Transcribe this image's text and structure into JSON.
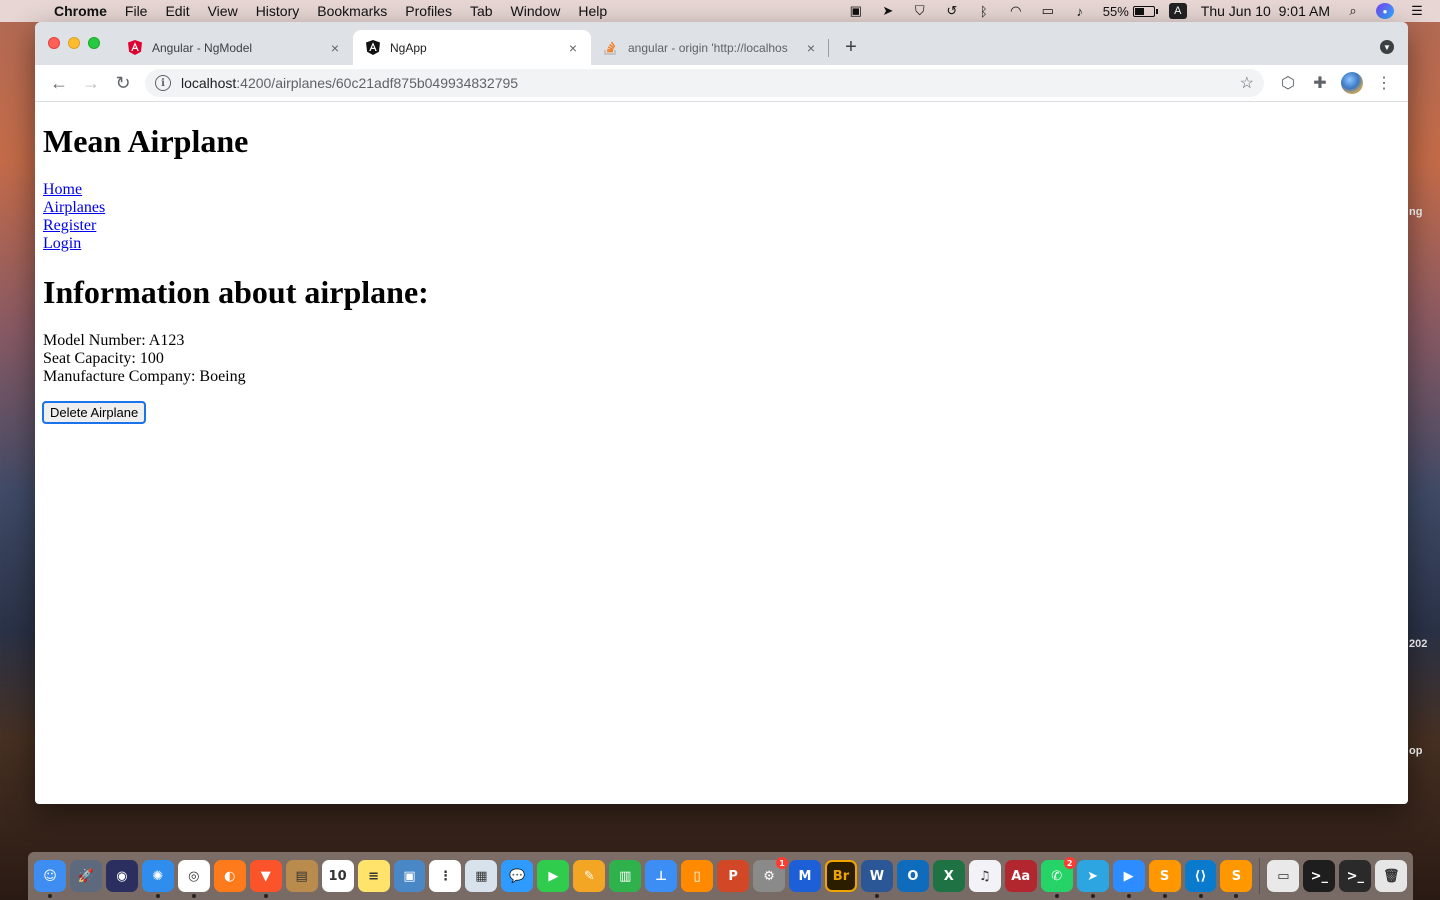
{
  "menubar": {
    "app_name": "Chrome",
    "menus": [
      "File",
      "Edit",
      "View",
      "History",
      "Bookmarks",
      "Profiles",
      "Tab",
      "Window",
      "Help"
    ],
    "battery_percent": "55%",
    "battery_level": 0.55,
    "input_source": "A",
    "datetime": "Thu Jun 10  9:01 AM"
  },
  "browser": {
    "tabs": [
      {
        "title": "Angular - NgModel",
        "favicon": "angular-red-icon",
        "active": false
      },
      {
        "title": "NgApp",
        "favicon": "angular-black-icon",
        "active": true
      },
      {
        "title": "angular - origin 'http://localhos",
        "favicon": "stackoverflow-icon",
        "active": false
      }
    ],
    "url_host": "localhost",
    "url_path": ":4200/airplanes/60c21adf875b049934832795"
  },
  "page": {
    "app_title": "Mean Airplane",
    "nav": {
      "home": "Home",
      "airplanes": "Airplanes",
      "register": "Register",
      "login": "Login"
    },
    "section_title": "Information about airplane:",
    "details": {
      "model_number": "Model Number: A123",
      "seat_capacity": "Seat Capacity: 100",
      "manufacture_company": "Manufacture Company: Boeing"
    },
    "delete_button": "Delete Airplane"
  },
  "dock": {
    "apps": [
      {
        "name": "finder-icon",
        "color": "#3d8ef0",
        "glyph": "☺",
        "running": true
      },
      {
        "name": "launchpad-icon",
        "color": "#5d6a7e",
        "glyph": "🚀",
        "running": false
      },
      {
        "name": "siri-icon",
        "color": "#2b2f5f",
        "glyph": "◉",
        "running": false
      },
      {
        "name": "safari-icon",
        "color": "#2f8ded",
        "glyph": "✺",
        "running": true
      },
      {
        "name": "chrome-icon",
        "color": "#ffffff",
        "glyph": "◎",
        "running": true
      },
      {
        "name": "firefox-icon",
        "color": "#ff7a1a",
        "glyph": "◐",
        "running": false
      },
      {
        "name": "brave-icon",
        "color": "#fb542b",
        "glyph": "▼",
        "running": true
      },
      {
        "name": "contacts-icon",
        "color": "#b98b4d",
        "glyph": "▤",
        "running": false
      },
      {
        "name": "calendar-icon",
        "color": "#ffffff",
        "glyph": "10",
        "running": false
      },
      {
        "name": "notes-icon",
        "color": "#ffe36b",
        "glyph": "≡",
        "running": false
      },
      {
        "name": "preview-icon",
        "color": "#4a87c7",
        "glyph": "▣",
        "running": false
      },
      {
        "name": "reminders-icon",
        "color": "#ffffff",
        "glyph": "⋮",
        "running": false
      },
      {
        "name": "photos-viewer-icon",
        "color": "#d8e2ec",
        "glyph": "▦",
        "running": false
      },
      {
        "name": "messages-icon",
        "color": "#2f9bff",
        "glyph": "💬",
        "running": false
      },
      {
        "name": "facetime-icon",
        "color": "#2fcc4e",
        "glyph": "▶",
        "running": false
      },
      {
        "name": "pages-icon",
        "color": "#f3a623",
        "glyph": "✎",
        "running": false
      },
      {
        "name": "numbers-icon",
        "color": "#2fb24c",
        "glyph": "▥",
        "running": false
      },
      {
        "name": "keynote-icon",
        "color": "#3c8ef5",
        "glyph": "⊥",
        "running": false
      },
      {
        "name": "books-icon",
        "color": "#ff8a00",
        "glyph": "▯",
        "running": false
      },
      {
        "name": "powerpoint-icon",
        "color": "#d24726",
        "glyph": "P",
        "running": false
      },
      {
        "name": "system-preferences-icon",
        "color": "#8a8a8a",
        "glyph": "⚙",
        "running": false,
        "badge": "1"
      },
      {
        "name": "malwarebytes-icon",
        "color": "#1d5fd6",
        "glyph": "M",
        "running": false
      },
      {
        "name": "bridge-icon",
        "color": "#2b1d00",
        "glyph": "Br",
        "running": false
      },
      {
        "name": "word-icon",
        "color": "#2b5797",
        "glyph": "W",
        "running": true
      },
      {
        "name": "outlook-icon",
        "color": "#0f6cbd",
        "glyph": "O",
        "running": false
      },
      {
        "name": "excel-icon",
        "color": "#1f7244",
        "glyph": "X",
        "running": false
      },
      {
        "name": "itunes-icon",
        "color": "#f2f2f7",
        "glyph": "♫",
        "running": false
      },
      {
        "name": "dictionary-icon",
        "color": "#b2262d",
        "glyph": "Aa",
        "running": false
      },
      {
        "name": "whatsapp-icon",
        "color": "#25d366",
        "glyph": "✆",
        "running": true,
        "badge": "2"
      },
      {
        "name": "telegram-icon",
        "color": "#2ca5e0",
        "glyph": "➤",
        "running": true
      },
      {
        "name": "zoom-icon",
        "color": "#2d8cff",
        "glyph": "▶",
        "running": true
      },
      {
        "name": "sublime-icon",
        "color": "#ff9800",
        "glyph": "S",
        "running": true
      },
      {
        "name": "vscode-icon",
        "color": "#0a7acc",
        "glyph": "⟨⟩",
        "running": true
      },
      {
        "name": "sublime-merge-icon",
        "color": "#ff9800",
        "glyph": "S",
        "running": true
      }
    ],
    "tray": [
      {
        "name": "nvidia-window-thumb-icon",
        "color": "#e9e9e9",
        "glyph": "▭"
      },
      {
        "name": "terminal-thumb-icon",
        "color": "#1e1e1e",
        "glyph": ">_"
      },
      {
        "name": "terminal-thumb-2-icon",
        "color": "#2a2a2a",
        "glyph": ">_"
      },
      {
        "name": "trash-icon",
        "color": "#e6e6e6",
        "glyph": "🗑"
      }
    ]
  }
}
